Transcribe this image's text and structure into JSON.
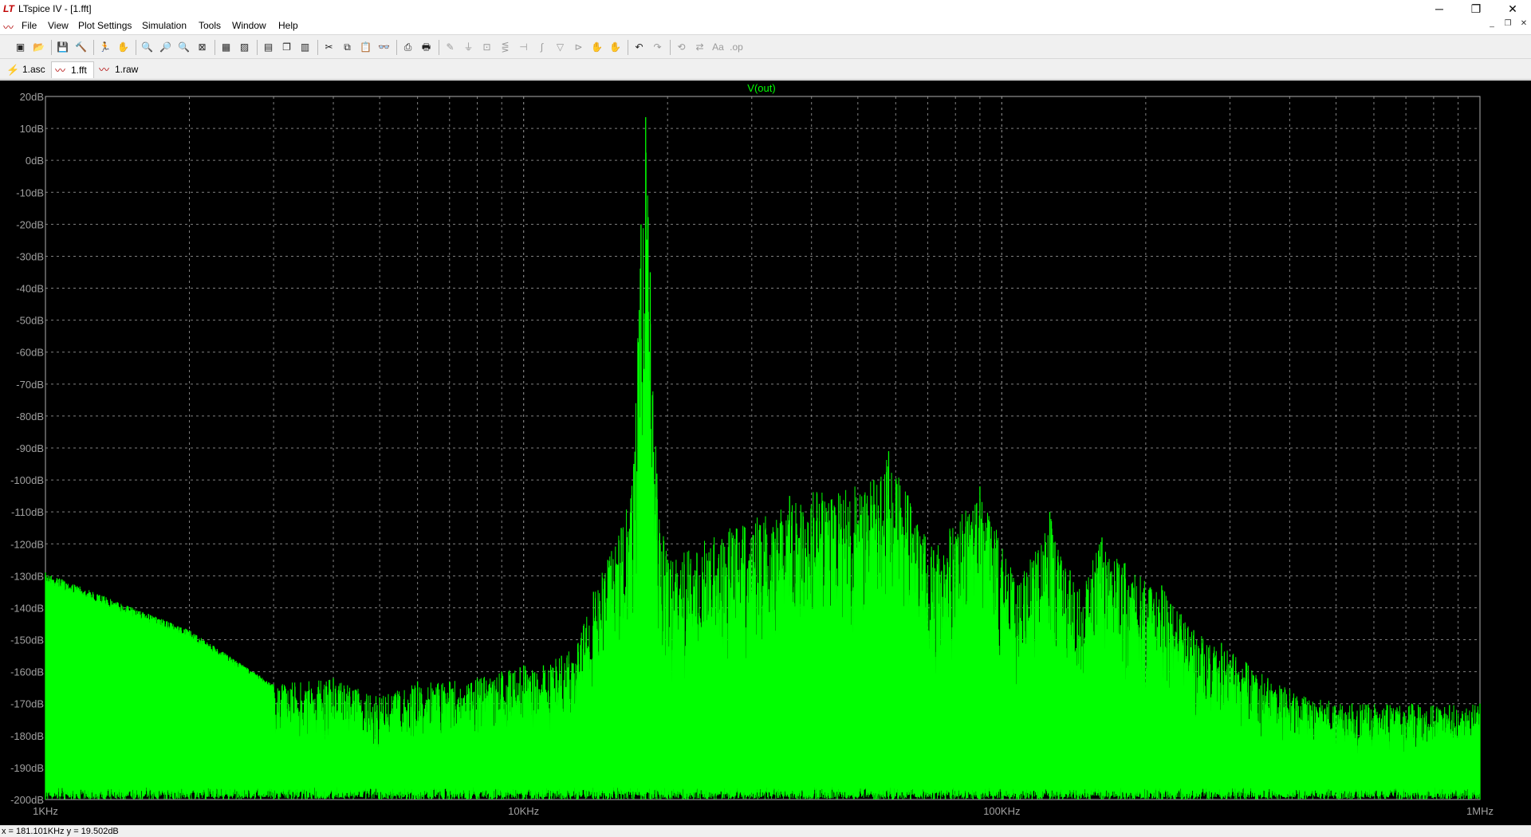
{
  "window": {
    "title": "LTspice IV - [1.fft]",
    "logo_text": "LT",
    "minimize_glyph": "─",
    "restore_glyph": "❐",
    "close_glyph": "✕",
    "mdi_minimize_glyph": "_",
    "mdi_restore_glyph": "❐",
    "mdi_close_glyph": "✕"
  },
  "menu": [
    "File",
    "View",
    "Plot Settings",
    "Simulation",
    "Tools",
    "Window",
    "Help"
  ],
  "toolbar": {
    "buttons": [
      {
        "name": "new-schematic-icon",
        "glyph": "▣"
      },
      {
        "name": "open-icon",
        "glyph": "📂"
      },
      {
        "name": "save-icon",
        "glyph": "💾"
      },
      {
        "name": "control-panel-icon",
        "glyph": "🔨"
      },
      {
        "name": "run-icon",
        "glyph": "🏃",
        "dim": true
      },
      {
        "name": "halt-icon",
        "glyph": "✋",
        "dim": true
      },
      {
        "name": "zoom-in-icon",
        "glyph": "🔍"
      },
      {
        "name": "zoom-pan-icon",
        "glyph": "🔎"
      },
      {
        "name": "zoom-out-icon",
        "glyph": "🔍"
      },
      {
        "name": "zoom-fit-icon",
        "glyph": "⊠"
      },
      {
        "name": "autorange-icon",
        "glyph": "▦"
      },
      {
        "name": "mark-unref-icon",
        "glyph": "▨"
      },
      {
        "name": "tile-horizontal-icon",
        "glyph": "▤"
      },
      {
        "name": "cascade-icon",
        "glyph": "❐"
      },
      {
        "name": "tile-vertical-icon",
        "glyph": "▥"
      },
      {
        "name": "cut-icon",
        "glyph": "✂"
      },
      {
        "name": "copy-icon",
        "glyph": "⧉"
      },
      {
        "name": "paste-icon",
        "glyph": "📋"
      },
      {
        "name": "find-icon",
        "glyph": "👓"
      },
      {
        "name": "print-preview-icon",
        "glyph": "⎙"
      },
      {
        "name": "print-icon",
        "glyph": "🖶"
      },
      {
        "name": "wire-icon",
        "glyph": "✎",
        "dim": true
      },
      {
        "name": "ground-icon",
        "glyph": "⏚",
        "dim": true
      },
      {
        "name": "label-net-icon",
        "glyph": "⊡",
        "dim": true
      },
      {
        "name": "resistor-icon",
        "glyph": "⋚",
        "dim": true
      },
      {
        "name": "capacitor-icon",
        "glyph": "⊣",
        "dim": true
      },
      {
        "name": "inductor-icon",
        "glyph": "∫",
        "dim": true
      },
      {
        "name": "diode-icon",
        "glyph": "▽",
        "dim": true
      },
      {
        "name": "component-icon",
        "glyph": "⊳",
        "dim": true
      },
      {
        "name": "move-icon",
        "glyph": "✋",
        "dim": true
      },
      {
        "name": "drag-icon",
        "glyph": "✋",
        "dim": true
      },
      {
        "name": "undo-icon",
        "glyph": "↶"
      },
      {
        "name": "redo-icon",
        "glyph": "↷",
        "dim": true
      },
      {
        "name": "rotate-icon",
        "glyph": "⟲",
        "dim": true
      },
      {
        "name": "mirror-icon",
        "glyph": "⇄",
        "dim": true
      },
      {
        "name": "text-icon",
        "glyph": "Aa",
        "dim": true
      },
      {
        "name": "spice-directive-icon",
        "glyph": ".op",
        "dim": true
      }
    ]
  },
  "tabs": [
    {
      "label": "1.asc",
      "icon": "⚡",
      "active": false
    },
    {
      "label": "1.fft",
      "icon": "〰",
      "active": true
    },
    {
      "label": "1.raw",
      "icon": "〰",
      "active": false
    }
  ],
  "status": {
    "cursor_readout": "x = 181.101KHz   y = 19.502dB"
  },
  "colors": {
    "trace": "#00ff00",
    "background": "#000000",
    "grid": "#808080",
    "axis_labels": "#a0a0a0"
  },
  "chart_data": {
    "type": "line",
    "title": "V(out)",
    "xscale": "log",
    "xlim": [
      1000,
      1000000
    ],
    "ylim": [
      -200,
      20
    ],
    "grid": true,
    "x_tick_labels": [
      "1KHz",
      "10KHz",
      "100KHz",
      "1MHz"
    ],
    "y_tick_labels": [
      "20dB",
      "10dB",
      "0dB",
      "-10dB",
      "-20dB",
      "-30dB",
      "-40dB",
      "-50dB",
      "-60dB",
      "-70dB",
      "-80dB",
      "-90dB",
      "-100dB",
      "-110dB",
      "-120dB",
      "-130dB",
      "-140dB",
      "-150dB",
      "-160dB",
      "-170dB",
      "-180dB",
      "-190dB",
      "-200dB"
    ],
    "series": [
      {
        "name": "V(out)",
        "fundamental_hz": 18000,
        "fundamental_db": 13.5,
        "peaks": [
          {
            "x": 1000,
            "y": -129
          },
          {
            "x": 2000,
            "y": -147
          },
          {
            "x": 3000,
            "y": -164
          },
          {
            "x": 4000,
            "y": -162
          },
          {
            "x": 5000,
            "y": -168
          },
          {
            "x": 6000,
            "y": -163
          },
          {
            "x": 7000,
            "y": -163
          },
          {
            "x": 8000,
            "y": -162
          },
          {
            "x": 9000,
            "y": -160
          },
          {
            "x": 10000,
            "y": -158
          },
          {
            "x": 11000,
            "y": -158
          },
          {
            "x": 12000,
            "y": -155
          },
          {
            "x": 13000,
            "y": -151
          },
          {
            "x": 14000,
            "y": -135
          },
          {
            "x": 15000,
            "y": -125
          },
          {
            "x": 16000,
            "y": -115
          },
          {
            "x": 17000,
            "y": -95
          },
          {
            "x": 17600,
            "y": -20
          },
          {
            "x": 18000,
            "y": 13.5
          },
          {
            "x": 18400,
            "y": -35
          },
          {
            "x": 19000,
            "y": -98
          },
          {
            "x": 20000,
            "y": -125
          },
          {
            "x": 36000,
            "y": -105
          },
          {
            "x": 54000,
            "y": -100
          },
          {
            "x": 58000,
            "y": -91
          },
          {
            "x": 72000,
            "y": -122
          },
          {
            "x": 90000,
            "y": -102
          },
          {
            "x": 108000,
            "y": -133
          },
          {
            "x": 126000,
            "y": -110
          },
          {
            "x": 144000,
            "y": -135
          },
          {
            "x": 162000,
            "y": -118
          },
          {
            "x": 181000,
            "y": -126
          },
          {
            "x": 216000,
            "y": -133
          },
          {
            "x": 252000,
            "y": -147
          },
          {
            "x": 288000,
            "y": -151
          },
          {
            "x": 324000,
            "y": -157
          },
          {
            "x": 360000,
            "y": -162
          },
          {
            "x": 432000,
            "y": -168
          },
          {
            "x": 540000,
            "y": -170
          },
          {
            "x": 720000,
            "y": -170
          },
          {
            "x": 1000000,
            "y": -170
          }
        ]
      }
    ]
  }
}
